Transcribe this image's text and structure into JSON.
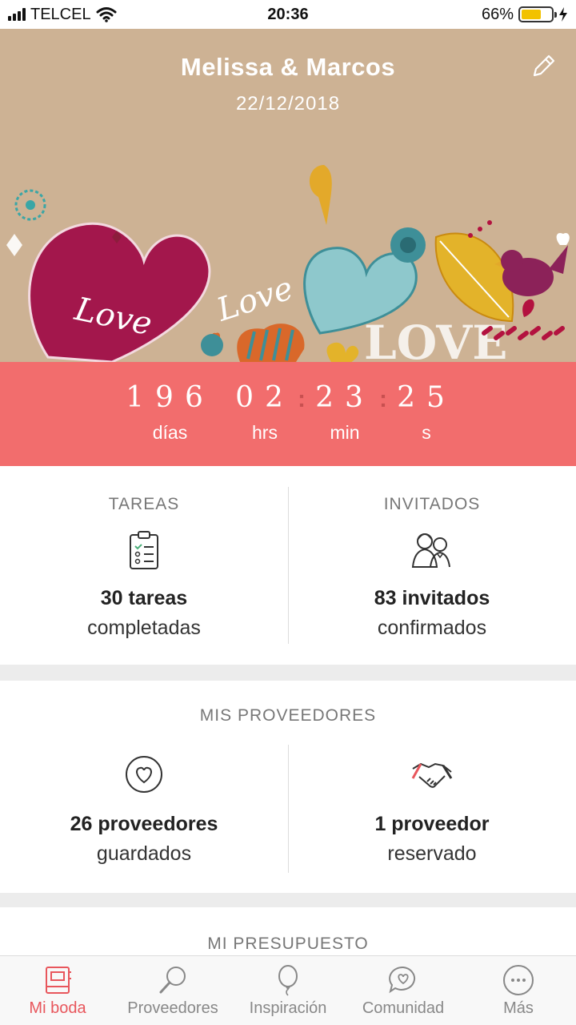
{
  "status": {
    "carrier": "TELCEL",
    "time": "20:36",
    "battery_pct": "66%",
    "battery_level": 0.66
  },
  "hero": {
    "couple": "Melissa & Marcos",
    "date": "22/12/2018",
    "art_words": [
      "Love",
      "Love",
      "LOVE"
    ]
  },
  "countdown": {
    "days": "196",
    "hours": "02",
    "minutes": "23",
    "seconds": "25",
    "days_label": "días",
    "hours_label": "hrs",
    "minutes_label": "min",
    "seconds_label": "s"
  },
  "tasks": {
    "title": "TAREAS",
    "count": "30 tareas",
    "sub": "completadas",
    "icon": "clipboard-checklist-icon"
  },
  "guests": {
    "title": "INVITADOS",
    "count": "83 invitados",
    "sub": "confirmados",
    "icon": "couple-icon"
  },
  "vendors": {
    "title": "MIS PROVEEDORES",
    "saved_count": "26 proveedores",
    "saved_sub": "guardados",
    "booked_count": "1 proveedor",
    "booked_sub": "reservado"
  },
  "budget": {
    "title": "MI PRESUPUESTO"
  },
  "tabs": [
    {
      "label": "Mi boda",
      "icon": "notebook-icon",
      "active": true
    },
    {
      "label": "Proveedores",
      "icon": "magnifier-icon",
      "active": false
    },
    {
      "label": "Inspiración",
      "icon": "balloon-icon",
      "active": false
    },
    {
      "label": "Comunidad",
      "icon": "chat-heart-icon",
      "active": false
    },
    {
      "label": "Más",
      "icon": "more-icon",
      "active": false
    }
  ],
  "colors": {
    "accent": "#f26d6d",
    "hero_bg": "#cdb294",
    "active_tab": "#e8565c"
  }
}
